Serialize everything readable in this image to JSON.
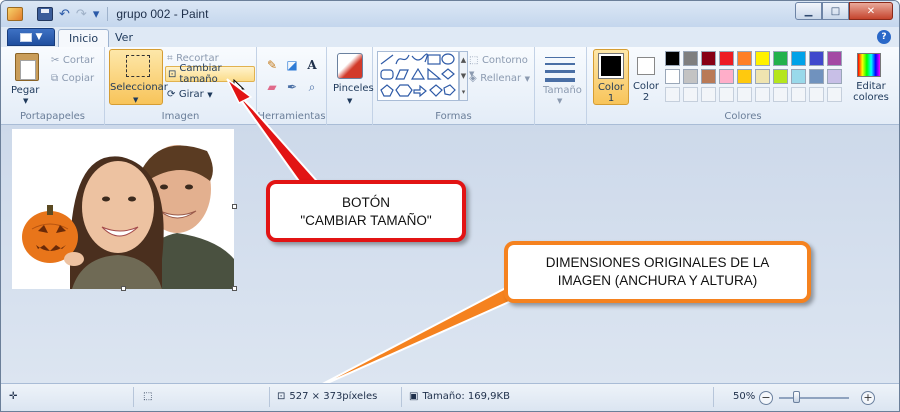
{
  "window": {
    "title": "grupo 002 - Paint",
    "buttons": {
      "minimize": "▁",
      "maximize": "□",
      "close": "✕"
    }
  },
  "quick_access": {
    "undo": "↶",
    "redo": "↷",
    "customize": "▾"
  },
  "tabs": [
    {
      "label": "Inicio"
    },
    {
      "label": "Ver"
    }
  ],
  "help": "?",
  "ribbon": {
    "portapapeles": {
      "label": "Portapapeles",
      "pegar": "Pegar",
      "cortar": "Cortar",
      "copiar": "Copiar"
    },
    "imagen": {
      "label": "Imagen",
      "seleccionar": "Seleccionar",
      "recortar": "Recortar",
      "cambiar_tamano": "Cambiar tamaño",
      "girar": "Girar"
    },
    "herramientas": {
      "label": "Herramientas"
    },
    "pinceles": {
      "label": "Pinceles"
    },
    "formas": {
      "label": "Formas",
      "contorno": "Contorno",
      "rellenar": "Rellenar"
    },
    "tamano": {
      "label": "Tamaño"
    },
    "colores": {
      "label": "Colores",
      "color1": "Color\n1",
      "color1_a": "Color",
      "color1_b": "1",
      "color2_a": "Color",
      "color2_b": "2",
      "editar_a": "Editar",
      "editar_b": "colores"
    }
  },
  "palette": {
    "row1": [
      "#000000",
      "#7f7f7f",
      "#880015",
      "#ed1c24",
      "#ff7f27",
      "#fff200",
      "#22b14c",
      "#00a2e8",
      "#3f48cc",
      "#a349a4"
    ],
    "row2": [
      "#ffffff",
      "#c3c3c3",
      "#b97a57",
      "#ffaec9",
      "#ffc90e",
      "#efe4b0",
      "#b5e61d",
      "#99d9ea",
      "#7092be",
      "#c8bfe7"
    ]
  },
  "callouts": {
    "boton_line1": "BOTÓN",
    "boton_line2": "\"CAMBIAR TAMAÑO\"",
    "dim_line1": "DIMENSIONES ORIGINALES DE LA",
    "dim_line2": "IMAGEN (ANCHURA Y ALTURA)"
  },
  "statusbar": {
    "dimensions": "527 × 373píxeles",
    "size": "Tamaño: 169,9KB",
    "zoom": "50%",
    "zoom_minus": "−",
    "zoom_plus": "+"
  },
  "colors": {
    "red_callout": "#e21414",
    "orange_callout": "#f5821f",
    "accent": "#2a68c8"
  }
}
